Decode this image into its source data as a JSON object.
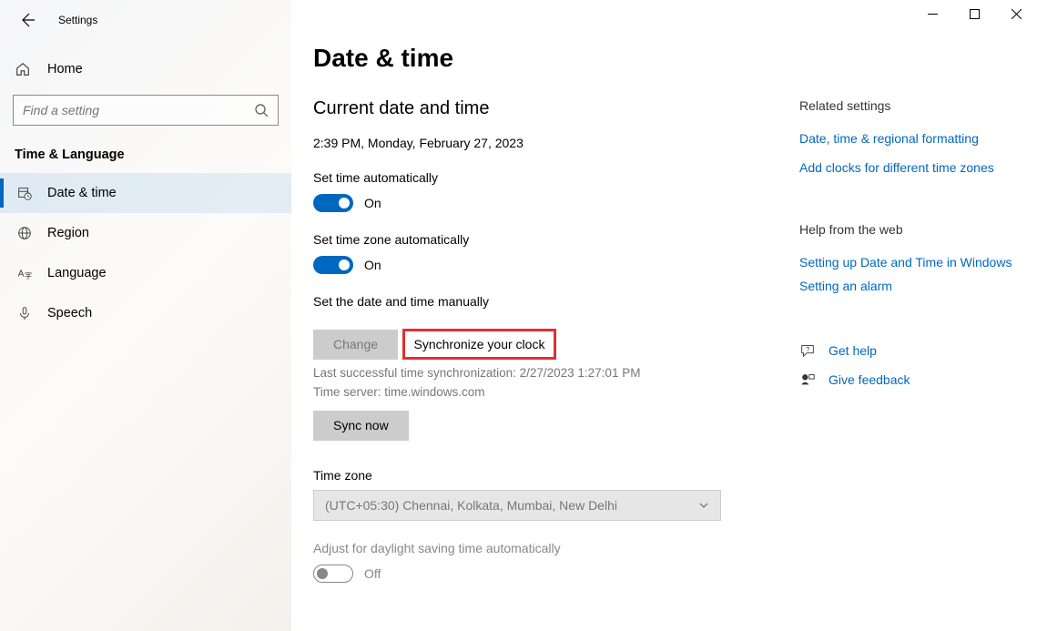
{
  "window": {
    "title": "Settings"
  },
  "sidebar": {
    "home": "Home",
    "search_placeholder": "Find a setting",
    "section": "Time & Language",
    "items": [
      {
        "label": "Date & time"
      },
      {
        "label": "Region"
      },
      {
        "label": "Language"
      },
      {
        "label": "Speech"
      }
    ]
  },
  "page": {
    "title": "Date & time",
    "current": {
      "heading": "Current date and time",
      "value": "2:39 PM, Monday, February 27, 2023"
    },
    "auto_time": {
      "label": "Set time automatically",
      "state": "On"
    },
    "auto_tz": {
      "label": "Set time zone automatically",
      "state": "On"
    },
    "manual": {
      "label": "Set the date and time manually",
      "button": "Change"
    },
    "sync": {
      "heading": "Synchronize your clock",
      "last": "Last successful time synchronization: 2/27/2023 1:27:01 PM",
      "server": "Time server: time.windows.com",
      "button": "Sync now"
    },
    "timezone": {
      "label": "Time zone",
      "value": "(UTC+05:30) Chennai, Kolkata, Mumbai, New Delhi"
    },
    "dst": {
      "label": "Adjust for daylight saving time automatically",
      "state": "Off"
    }
  },
  "related": {
    "heading": "Related settings",
    "links": [
      "Date, time & regional formatting",
      "Add clocks for different time zones"
    ]
  },
  "help": {
    "heading": "Help from the web",
    "links": [
      "Setting up Date and Time in Windows",
      "Setting an alarm"
    ],
    "get_help": "Get help",
    "feedback": "Give feedback"
  }
}
